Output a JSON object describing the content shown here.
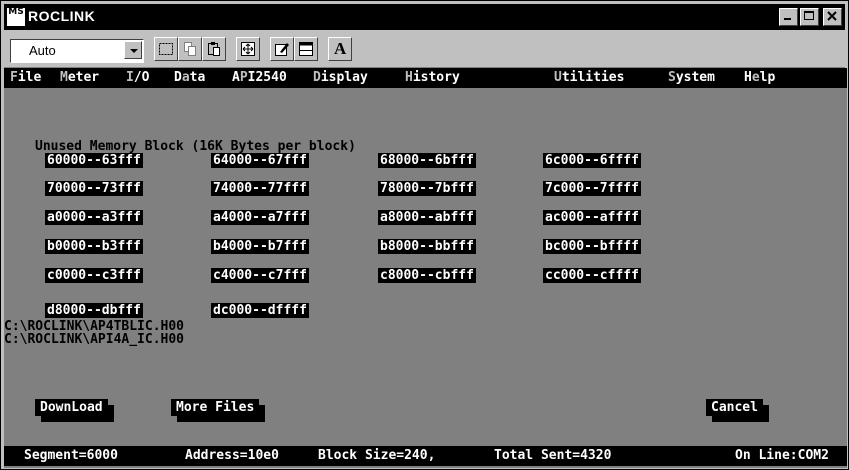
{
  "window": {
    "title": "ROCLINK",
    "app_icon_text": "MS",
    "buttons": [
      "minimize",
      "maximize",
      "close"
    ]
  },
  "toolbar": {
    "mode_select_value": "Auto",
    "buttons": [
      "select-icon",
      "copy-icon",
      "paste-icon",
      "fit-icon",
      "properties-icon",
      "window-icon",
      "font-icon"
    ],
    "font_button_label": "A"
  },
  "menu": [
    {
      "hot": "F",
      "rest": "ile"
    },
    {
      "hot": "M",
      "rest": "eter"
    },
    {
      "hot": "I",
      "rest": "/O"
    },
    {
      "pre": "D",
      "hot": "a",
      "rest": "ta"
    },
    {
      "pre": "A",
      "hot": "P",
      "rest": "I2540"
    },
    {
      "hot": "D",
      "rest": "isplay"
    },
    {
      "hot": "H",
      "rest": "istory"
    },
    {
      "hot": "U",
      "rest": "tilities"
    },
    {
      "hot": "S",
      "rest": "ystem"
    },
    {
      "pre": "H",
      "hot": "e",
      "rest": "lp"
    }
  ],
  "content": {
    "heading": "Unused Memory Block (16K Bytes per block)",
    "blocks": [
      [
        "60000--63fff",
        "64000--67fff",
        "68000--6bfff",
        "6c000--6ffff"
      ],
      [
        "70000--73fff",
        "74000--77fff",
        "78000--7bfff",
        "7c000--7ffff"
      ],
      [
        "a0000--a3fff",
        "a4000--a7fff",
        "a8000--abfff",
        "ac000--affff"
      ],
      [
        "b0000--b3fff",
        "b4000--b7fff",
        "b8000--bbfff",
        "bc000--bffff"
      ],
      [
        "c0000--c3fff",
        "c4000--c7fff",
        "c8000--cbfff",
        "cc000--cffff"
      ],
      [
        "d8000--dbfff",
        "dc000--dffff"
      ]
    ],
    "paths": [
      "C:\\ROCLINK\\AP4TBLIC.H00",
      "C:\\ROCLINK\\API4A_IC.H00"
    ],
    "buttons": {
      "download": "DownLoad",
      "more_files": "More Files",
      "cancel": "Cancel"
    }
  },
  "status": {
    "segment": "Segment=6000",
    "address": "Address=10e0",
    "block_size": "Block Size=240,",
    "total_sent": "Total Sent=4320",
    "online": "On Line:COM2"
  }
}
